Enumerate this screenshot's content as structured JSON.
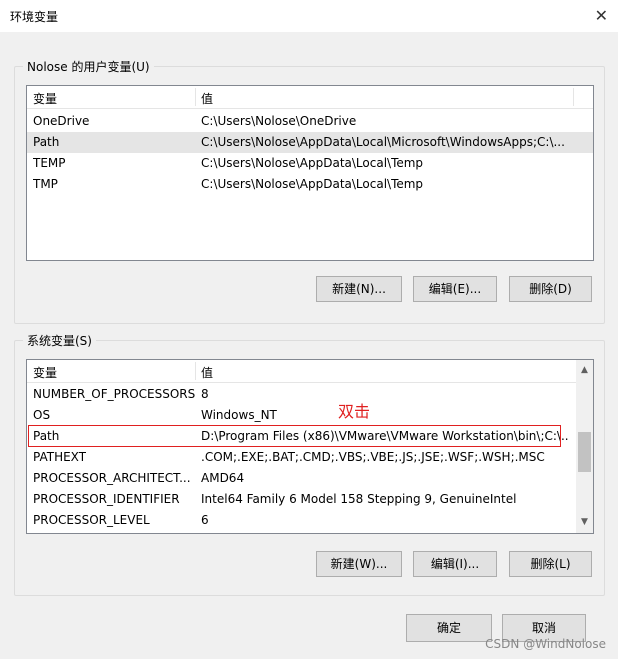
{
  "window": {
    "title": "环境变量",
    "close_glyph": "✕"
  },
  "user_vars": {
    "group_label": "Nolose 的用户变量(U)",
    "columns": [
      "变量",
      "值"
    ],
    "rows": [
      {
        "name": "OneDrive",
        "value": "C:\\Users\\Nolose\\OneDrive"
      },
      {
        "name": "Path",
        "value": "C:\\Users\\Nolose\\AppData\\Local\\Microsoft\\WindowsApps;C:\\..."
      },
      {
        "name": "TEMP",
        "value": "C:\\Users\\Nolose\\AppData\\Local\\Temp"
      },
      {
        "name": "TMP",
        "value": "C:\\Users\\Nolose\\AppData\\Local\\Temp"
      }
    ],
    "selected_index": 1,
    "buttons": {
      "new": "新建(N)...",
      "edit": "编辑(E)...",
      "delete": "删除(D)"
    }
  },
  "system_vars": {
    "group_label": "系统变量(S)",
    "columns": [
      "变量",
      "值"
    ],
    "rows": [
      {
        "name": "NUMBER_OF_PROCESSORS",
        "value": "8"
      },
      {
        "name": "OS",
        "value": "Windows_NT"
      },
      {
        "name": "Path",
        "value": "D:\\Program Files (x86)\\VMware\\VMware Workstation\\bin\\;C:\\..."
      },
      {
        "name": "PATHEXT",
        "value": ".COM;.EXE;.BAT;.CMD;.VBS;.VBE;.JS;.JSE;.WSF;.WSH;.MSC"
      },
      {
        "name": "PROCESSOR_ARCHITECT...",
        "value": "AMD64"
      },
      {
        "name": "PROCESSOR_IDENTIFIER",
        "value": "Intel64 Family 6 Model 158 Stepping 9, GenuineIntel"
      },
      {
        "name": "PROCESSOR_LEVEL",
        "value": "6"
      }
    ],
    "buttons": {
      "new": "新建(W)...",
      "edit": "编辑(I)...",
      "delete": "删除(L)"
    },
    "annotation": "双击"
  },
  "footer": {
    "ok": "确定",
    "cancel": "取消"
  },
  "watermark": "CSDN @WindNolose",
  "colors": {
    "annotation": "#e02020",
    "selected_row": "#e5e5e5"
  },
  "icons": {
    "scroll_up": "▲",
    "scroll_down": "▼"
  }
}
